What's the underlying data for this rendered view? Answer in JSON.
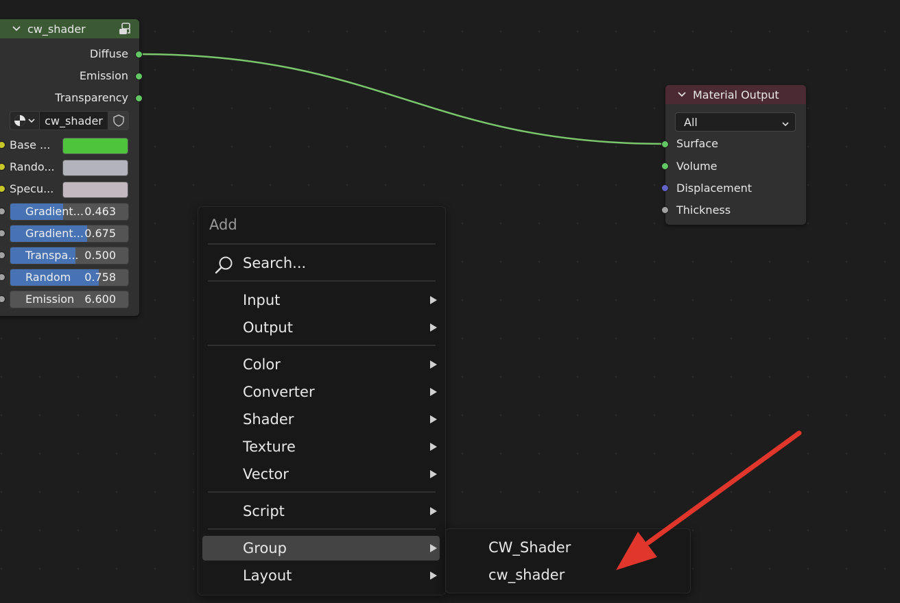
{
  "colors": {
    "background": "#1d1d1d",
    "group_header": "#3b5a34",
    "output_header": "#4c2a33",
    "link": "#7ac86b",
    "socket_shader": "#63c763",
    "socket_color": "#c7c729",
    "socket_vector": "#6363c7",
    "socket_float": "#a1a1a1",
    "slider_fill": "#4772b3",
    "annotation_arrow": "#e0362c"
  },
  "group_node": {
    "title": "cw_shader",
    "header_icon": "node-tree-icon",
    "outputs": [
      "Diffuse",
      "Emission",
      "Transparency"
    ],
    "datablock": {
      "type_icon": "node-tree-type-icon",
      "name": "cw_shader",
      "fake_user_icon": "shield-icon"
    },
    "color_inputs": [
      {
        "label": "Base ...",
        "color": "#4ec33c"
      },
      {
        "label": "Rando...",
        "color": "#b3b4bb"
      },
      {
        "label": "Specu...",
        "color": "#c4b8c0"
      }
    ],
    "value_inputs": [
      {
        "label": "Gradient...",
        "value": "0.463",
        "fraction": 0.463
      },
      {
        "label": "Gradient...",
        "value": "0.675",
        "fraction": 0.675
      },
      {
        "label": "Transpa...",
        "value": "0.500",
        "fraction": 0.5
      },
      {
        "label": "Random",
        "value": "0.758",
        "fraction": 0.758
      },
      {
        "label": "Emission",
        "value": "6.600",
        "fraction": 0
      }
    ]
  },
  "output_node": {
    "title": "Material Output",
    "target": "All",
    "inputs": [
      "Surface",
      "Volume",
      "Displacement",
      "Thickness"
    ]
  },
  "add_menu": {
    "title": "Add",
    "search": "Search...",
    "items": [
      "Input",
      "Output",
      "Color",
      "Converter",
      "Shader",
      "Texture",
      "Vector",
      "Script",
      "Group",
      "Layout"
    ],
    "active": "Group"
  },
  "group_submenu": {
    "items": [
      "CW_Shader",
      "cw_shader"
    ]
  }
}
